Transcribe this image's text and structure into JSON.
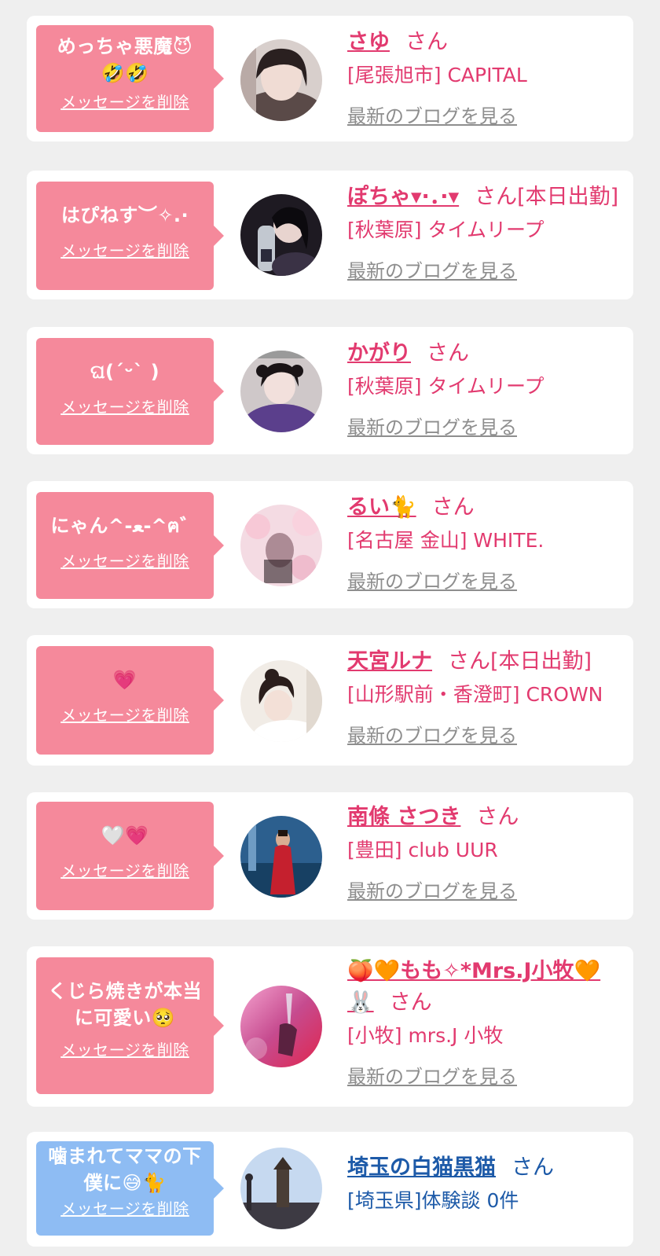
{
  "common": {
    "delete_label": "メッセージを削除",
    "blog_label": "最新のブログを見る"
  },
  "items": [
    {
      "message_lines": [
        "めっちゃ悪魔😈",
        "🤣🤣"
      ],
      "name": "さゆ",
      "honorific": "さん",
      "extra": "",
      "shop": "[尾張旭市] CAPITAL",
      "has_blog": true
    },
    {
      "message_lines": [
        "はぴねす︶✧.·"
      ],
      "name": "ぽちゃ▾·．·▾",
      "honorific": "さん",
      "extra": "[本日出勤]",
      "shop": "[秋葉原] タイムリープ",
      "has_blog": true
    },
    {
      "message_lines": [
        "ଘ(ˊᵕˋ )"
      ],
      "name": "かがり",
      "honorific": "さん",
      "extra": "",
      "shop": "[秋葉原] タイムリープ",
      "has_blog": true
    },
    {
      "message_lines": [
        "にゃん^-ﻌ-^ฅ゛"
      ],
      "name": "るい🐈",
      "honorific": "さん",
      "extra": "",
      "shop": "[名古屋 金山] WHITE.",
      "has_blog": true
    },
    {
      "message_lines": [
        "💗"
      ],
      "name": "天宮ルナ",
      "honorific": "さん",
      "extra": "[本日出勤]",
      "shop": "[山形駅前・香澄町] CROWN",
      "has_blog": true
    },
    {
      "message_lines": [
        "🤍💗"
      ],
      "name": "南條 さつき",
      "honorific": "さん",
      "extra": "",
      "shop": "[豊田] club UUR",
      "has_blog": true
    },
    {
      "message_lines": [
        "くじら焼きが本当",
        "に可愛い🥺"
      ],
      "name": "🍑🧡もも✧*Mrs.J小牧🧡",
      "name_line2": "🐰",
      "honorific": "さん",
      "extra": "",
      "shop": "[小牧] mrs.J 小牧",
      "has_blog": true
    },
    {
      "message_lines": [
        "噛まれてママの下",
        "僕に😅🐈"
      ],
      "name": "埼玉の白猫黒猫",
      "honorific": "さん",
      "extra": "",
      "shop": "[埼玉県]体験談 0件",
      "has_blog": false
    }
  ],
  "colors": {
    "background": "#efefef",
    "card": "#ffffff",
    "bubble_pink": "#f5899b",
    "bubble_blue": "#8ebcf3",
    "name_pink": "#e23a6f",
    "name_blue": "#1d5aa8",
    "blog_gray": "#8e8e8e"
  }
}
